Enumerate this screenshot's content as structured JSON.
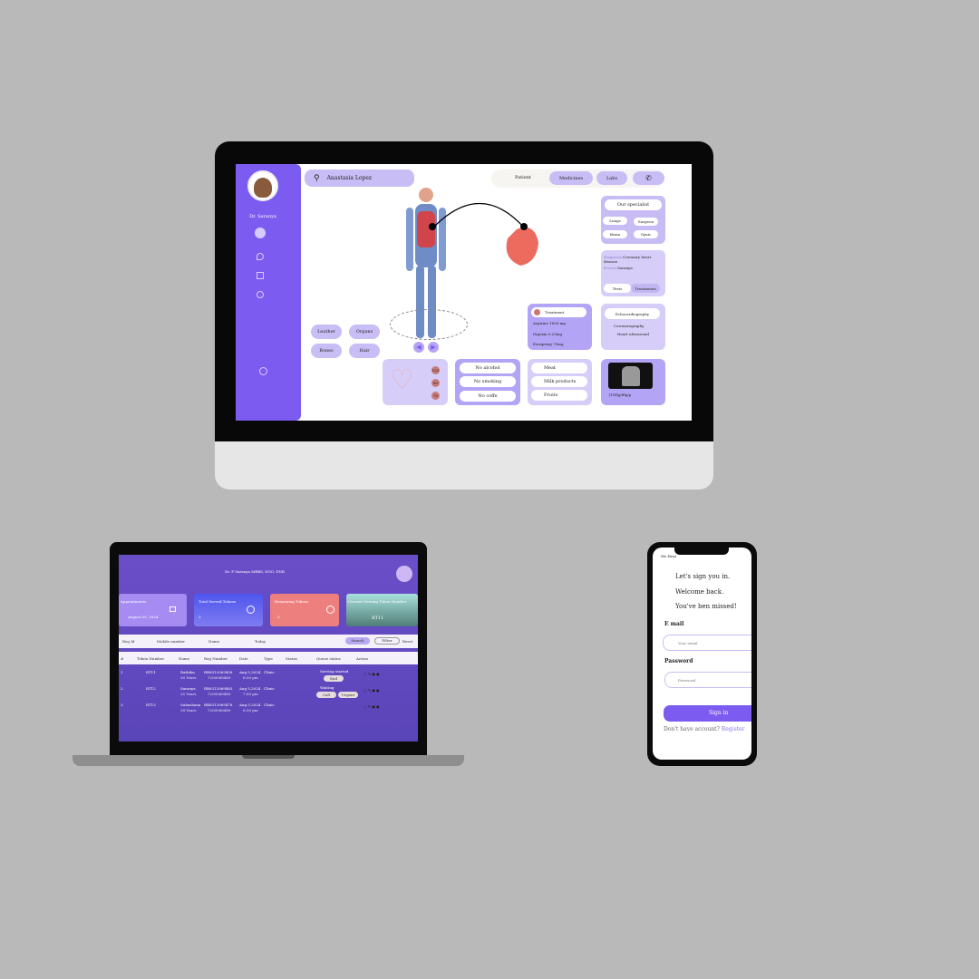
{
  "desktop": {
    "doctor_name": "Dr. Saranya",
    "search_value": "Anastasia Lopez",
    "tabs": [
      "Patient",
      "Medicines",
      "Labs"
    ],
    "body_parts": [
      "Leather",
      "Organs",
      "Bones",
      "Hair"
    ],
    "specialist": {
      "title": "Our specialist",
      "items": [
        "Lungs",
        "Surgeon",
        "Brain",
        "Gynic"
      ]
    },
    "diagnosis": {
      "label": "Diagnosis:",
      "value": "Coronary heart disease",
      "doctor_label": "Doctor:",
      "doctor": "Saranya",
      "tabs": [
        "Tests",
        "Treatments"
      ]
    },
    "treatment": {
      "title": "Treatment",
      "items": [
        "Aspirine 1000 mg",
        "Digoxin 0.25mg",
        "Eenspring 75mg"
      ]
    },
    "tests": [
      "Echocardiography",
      "Coronarography",
      "Heart ultrasound"
    ],
    "vitals_badges": [
      "120",
      "80",
      "70"
    ],
    "lifestyle": [
      "No alcohol",
      "No smoking",
      "No coffe"
    ],
    "diet": [
      "Meat",
      "Milk products",
      "Fruits"
    ],
    "xray_caption": "[1ßl]g/Blg/p"
  },
  "laptop": {
    "header": "Dr. P Saranya MBBS, DGO, DNB",
    "cards": [
      {
        "title": "Appointments",
        "value": "August 05, 2024",
        "color": "#a58bf2"
      },
      {
        "title": "Total Served Tokens",
        "value": "3",
        "color": "#5b5ef0"
      },
      {
        "title": "Remaining Tokens",
        "value": "3",
        "color": "#ee7f7f"
      },
      {
        "title": "Current Serving Token Number",
        "value": "RT11",
        "color": "#6ea89f"
      }
    ],
    "filters": {
      "reg_id": "Reg Id",
      "mobile": "Mobile number",
      "name": "Name",
      "date": "Today",
      "search": "Search",
      "filter": "Filter",
      "reset": "Reset"
    },
    "columns": [
      "#",
      "Token Number",
      "Name",
      "Reg Number",
      "Date",
      "Type",
      "Status",
      "Queue status",
      "Action"
    ],
    "rows": [
      {
        "n": "1",
        "token": "RT11",
        "name": "Rathika",
        "age": "30 Years",
        "reg": "RB8312069458",
        "phone": "7200068469",
        "date": "Aug 5,2024",
        "time": "6:30 pm",
        "type": "Clinic",
        "queue": "Serving started",
        "buttons": [
          "End"
        ]
      },
      {
        "n": "2",
        "token": "RT12",
        "name": "Saranya",
        "age": "25 Years",
        "reg": "RB8312069465",
        "phone": "7200068469",
        "date": "Aug 5,2024",
        "time": "7:00 pm",
        "type": "Clinic",
        "queue": "Waiting",
        "buttons": [
          "Call",
          "Urgent"
        ]
      },
      {
        "n": "3",
        "token": "RT13",
        "name": "Subashana",
        "age": "28 Years",
        "reg": "RB8312069478",
        "phone": "7200068469",
        "date": "Aug 5,2024",
        "time": "8:30 pm",
        "type": "Clinic",
        "queue": "",
        "buttons": []
      }
    ]
  },
  "phone": {
    "brand": "We Heal",
    "greeting": [
      "Let's sign you in.",
      "Welcome back.",
      "You've ben missed!"
    ],
    "email_label": "E mail",
    "email_placeholder": "Your email",
    "password_label": "Password",
    "password_placeholder": "Password",
    "signin": "Sign in",
    "no_account": "Don't have account?",
    "register": "Register"
  }
}
